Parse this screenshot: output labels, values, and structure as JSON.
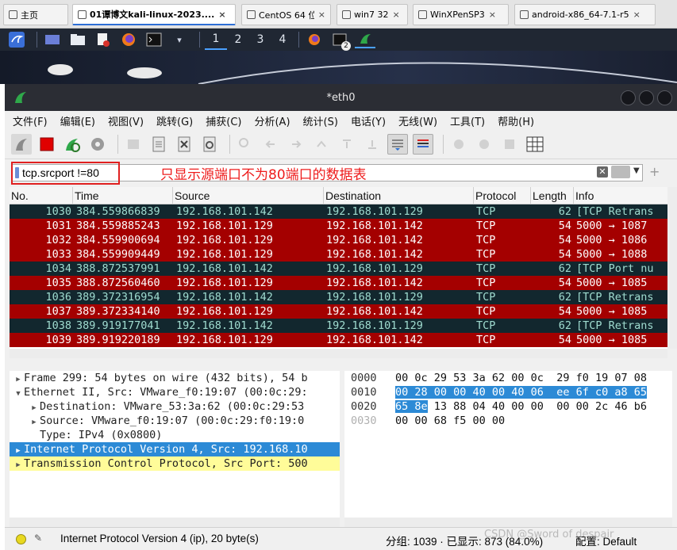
{
  "vm_tabs": [
    {
      "label": "主页",
      "icon": "home-icon",
      "active": false
    },
    {
      "label": "01谭博文kali-linux-2023....",
      "icon": "vm-icon",
      "active": true
    },
    {
      "label": "CentOS 64 位",
      "icon": "vm-icon",
      "active": false
    },
    {
      "label": "win7 32",
      "icon": "vm-icon",
      "active": false
    },
    {
      "label": "WinXPenSP3",
      "icon": "vm-icon",
      "active": false
    },
    {
      "label": "android-x86_64-7.1-r5",
      "icon": "vm-icon",
      "active": false
    }
  ],
  "tab_close": "×",
  "panel": {
    "workspaces": [
      "1",
      "2",
      "3",
      "4"
    ],
    "terminal_badge": "2"
  },
  "window": {
    "title": "*eth0"
  },
  "menu": [
    "文件(F)",
    "编辑(E)",
    "视图(V)",
    "跳转(G)",
    "捕获(C)",
    "分析(A)",
    "统计(S)",
    "电话(Y)",
    "无线(W)",
    "工具(T)",
    "帮助(H)"
  ],
  "filter": {
    "value": "tcp.srcport !=80",
    "annotation": "只显示源端口不为80端口的数据表"
  },
  "columns": [
    "No.",
    "Time",
    "Source",
    "Destination",
    "Protocol",
    "Length",
    "Info"
  ],
  "packets": [
    {
      "no": "1030",
      "time": "384.559866839",
      "src": "192.168.101.142",
      "dst": "192.168.101.129",
      "proto": "TCP",
      "len": "62",
      "info": "[TCP Retrans",
      "style": "dark"
    },
    {
      "no": "1031",
      "time": "384.559885243",
      "src": "192.168.101.129",
      "dst": "192.168.101.142",
      "proto": "TCP",
      "len": "54",
      "info": "5000 → 1087",
      "style": "red"
    },
    {
      "no": "1032",
      "time": "384.559900694",
      "src": "192.168.101.129",
      "dst": "192.168.101.142",
      "proto": "TCP",
      "len": "54",
      "info": "5000 → 1086",
      "style": "red"
    },
    {
      "no": "1033",
      "time": "384.559909449",
      "src": "192.168.101.129",
      "dst": "192.168.101.142",
      "proto": "TCP",
      "len": "54",
      "info": "5000 → 1088",
      "style": "red"
    },
    {
      "no": "1034",
      "time": "388.872537991",
      "src": "192.168.101.142",
      "dst": "192.168.101.129",
      "proto": "TCP",
      "len": "62",
      "info": "[TCP Port nu",
      "style": "dark"
    },
    {
      "no": "1035",
      "time": "388.872560460",
      "src": "192.168.101.129",
      "dst": "192.168.101.142",
      "proto": "TCP",
      "len": "54",
      "info": "5000 → 1085",
      "style": "red"
    },
    {
      "no": "1036",
      "time": "389.372316954",
      "src": "192.168.101.142",
      "dst": "192.168.101.129",
      "proto": "TCP",
      "len": "62",
      "info": "[TCP Retrans",
      "style": "dark"
    },
    {
      "no": "1037",
      "time": "389.372334140",
      "src": "192.168.101.129",
      "dst": "192.168.101.142",
      "proto": "TCP",
      "len": "54",
      "info": "5000 → 1085",
      "style": "red"
    },
    {
      "no": "1038",
      "time": "389.919177041",
      "src": "192.168.101.142",
      "dst": "192.168.101.129",
      "proto": "TCP",
      "len": "62",
      "info": "[TCP Retrans",
      "style": "dark"
    },
    {
      "no": "1039",
      "time": "389.919220189",
      "src": "192.168.101.129",
      "dst": "192.168.101.142",
      "proto": "TCP",
      "len": "54",
      "info": "5000 → 1085",
      "style": "red"
    }
  ],
  "details": [
    {
      "arrow": "▶",
      "indent": 0,
      "text": "Frame 299: 54 bytes on wire (432 bits), 54 b",
      "style": ""
    },
    {
      "arrow": "▼",
      "indent": 0,
      "text": "Ethernet II, Src: VMware_f0:19:07 (00:0c:29:",
      "style": ""
    },
    {
      "arrow": "▶",
      "indent": 1,
      "text": "Destination: VMware_53:3a:62 (00:0c:29:53",
      "style": ""
    },
    {
      "arrow": "▶",
      "indent": 1,
      "text": "Source: VMware_f0:19:07 (00:0c:29:f0:19:0",
      "style": ""
    },
    {
      "arrow": "",
      "indent": 1,
      "text": "Type: IPv4 (0x0800)",
      "style": ""
    },
    {
      "arrow": "▶",
      "indent": 0,
      "text": "Internet Protocol Version 4, Src: 192.168.10",
      "style": "sel"
    },
    {
      "arrow": "▶",
      "indent": 0,
      "text": "Transmission Control Protocol, Src Port: 500",
      "style": "yel"
    }
  ],
  "hex": [
    {
      "offset": "0000",
      "dim": false,
      "pre": "00 0c 29 53 3a 62 00 0c  29 f0 19 07 08",
      "hl": "",
      "post": ""
    },
    {
      "offset": "0010",
      "dim": false,
      "pre": "",
      "hl": "00 28 00 00 40 00 40 06  ee 6f c0 a8 65",
      "post": ""
    },
    {
      "offset": "0020",
      "dim": false,
      "pre": "",
      "hl": "65 8e",
      "post": " 13 88 04 40 00 00  00 00 2c 46 b6"
    },
    {
      "offset": "0030",
      "dim": true,
      "pre": "00 00 68 f5 00 00",
      "hl": "",
      "post": ""
    }
  ],
  "status": {
    "text": "Internet Protocol Version 4 (ip), 20 byte(s)",
    "stats": "分组: 1039 · 已显示: 873 (84.0%)",
    "profile": "配置: Default"
  },
  "watermark": "CSDN @Sword of despair",
  "colors": {
    "row_red": "#a40000",
    "row_dark": "#12272e",
    "selected": "#2c8ad6",
    "annotation": "#ee1c1c"
  }
}
